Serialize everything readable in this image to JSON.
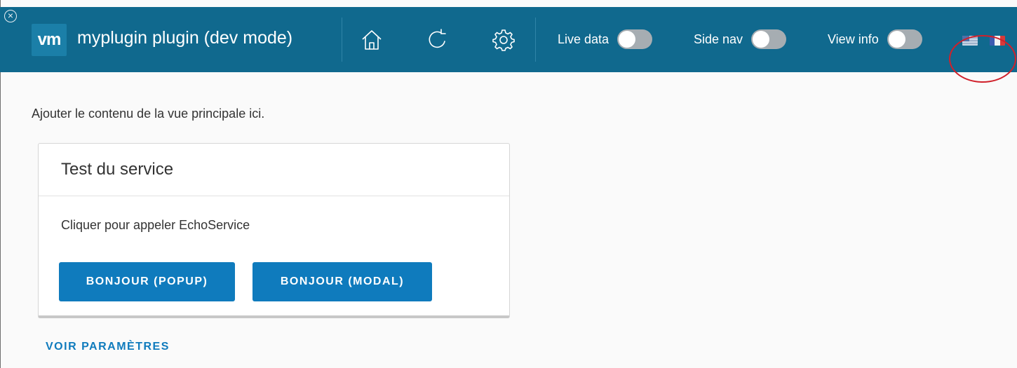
{
  "window": {
    "close_icon": "close-circle-icon"
  },
  "header": {
    "logo_text": "vm",
    "title": "myplugin plugin (dev mode)",
    "icons": [
      "home-icon",
      "refresh-icon",
      "gear-icon"
    ],
    "toggles": [
      {
        "label": "Live data",
        "on": false
      },
      {
        "label": "Side nav",
        "on": false
      },
      {
        "label": "View info",
        "on": false
      }
    ],
    "languages": [
      "us-flag-icon",
      "fr-flag-icon"
    ],
    "background_color": "#10698e"
  },
  "main": {
    "intro": "Ajouter le contenu de la vue principale ici.",
    "card": {
      "title": "Test du service",
      "text": "Cliquer pour appeler EchoService",
      "buttons": [
        "BONJOUR (POPUP)",
        "BONJOUR (MODAL)"
      ]
    },
    "settings_link": "VOIR PARAMÈTRES"
  },
  "colors": {
    "accent": "#0f7bbd",
    "annotation": "#d0202a"
  }
}
